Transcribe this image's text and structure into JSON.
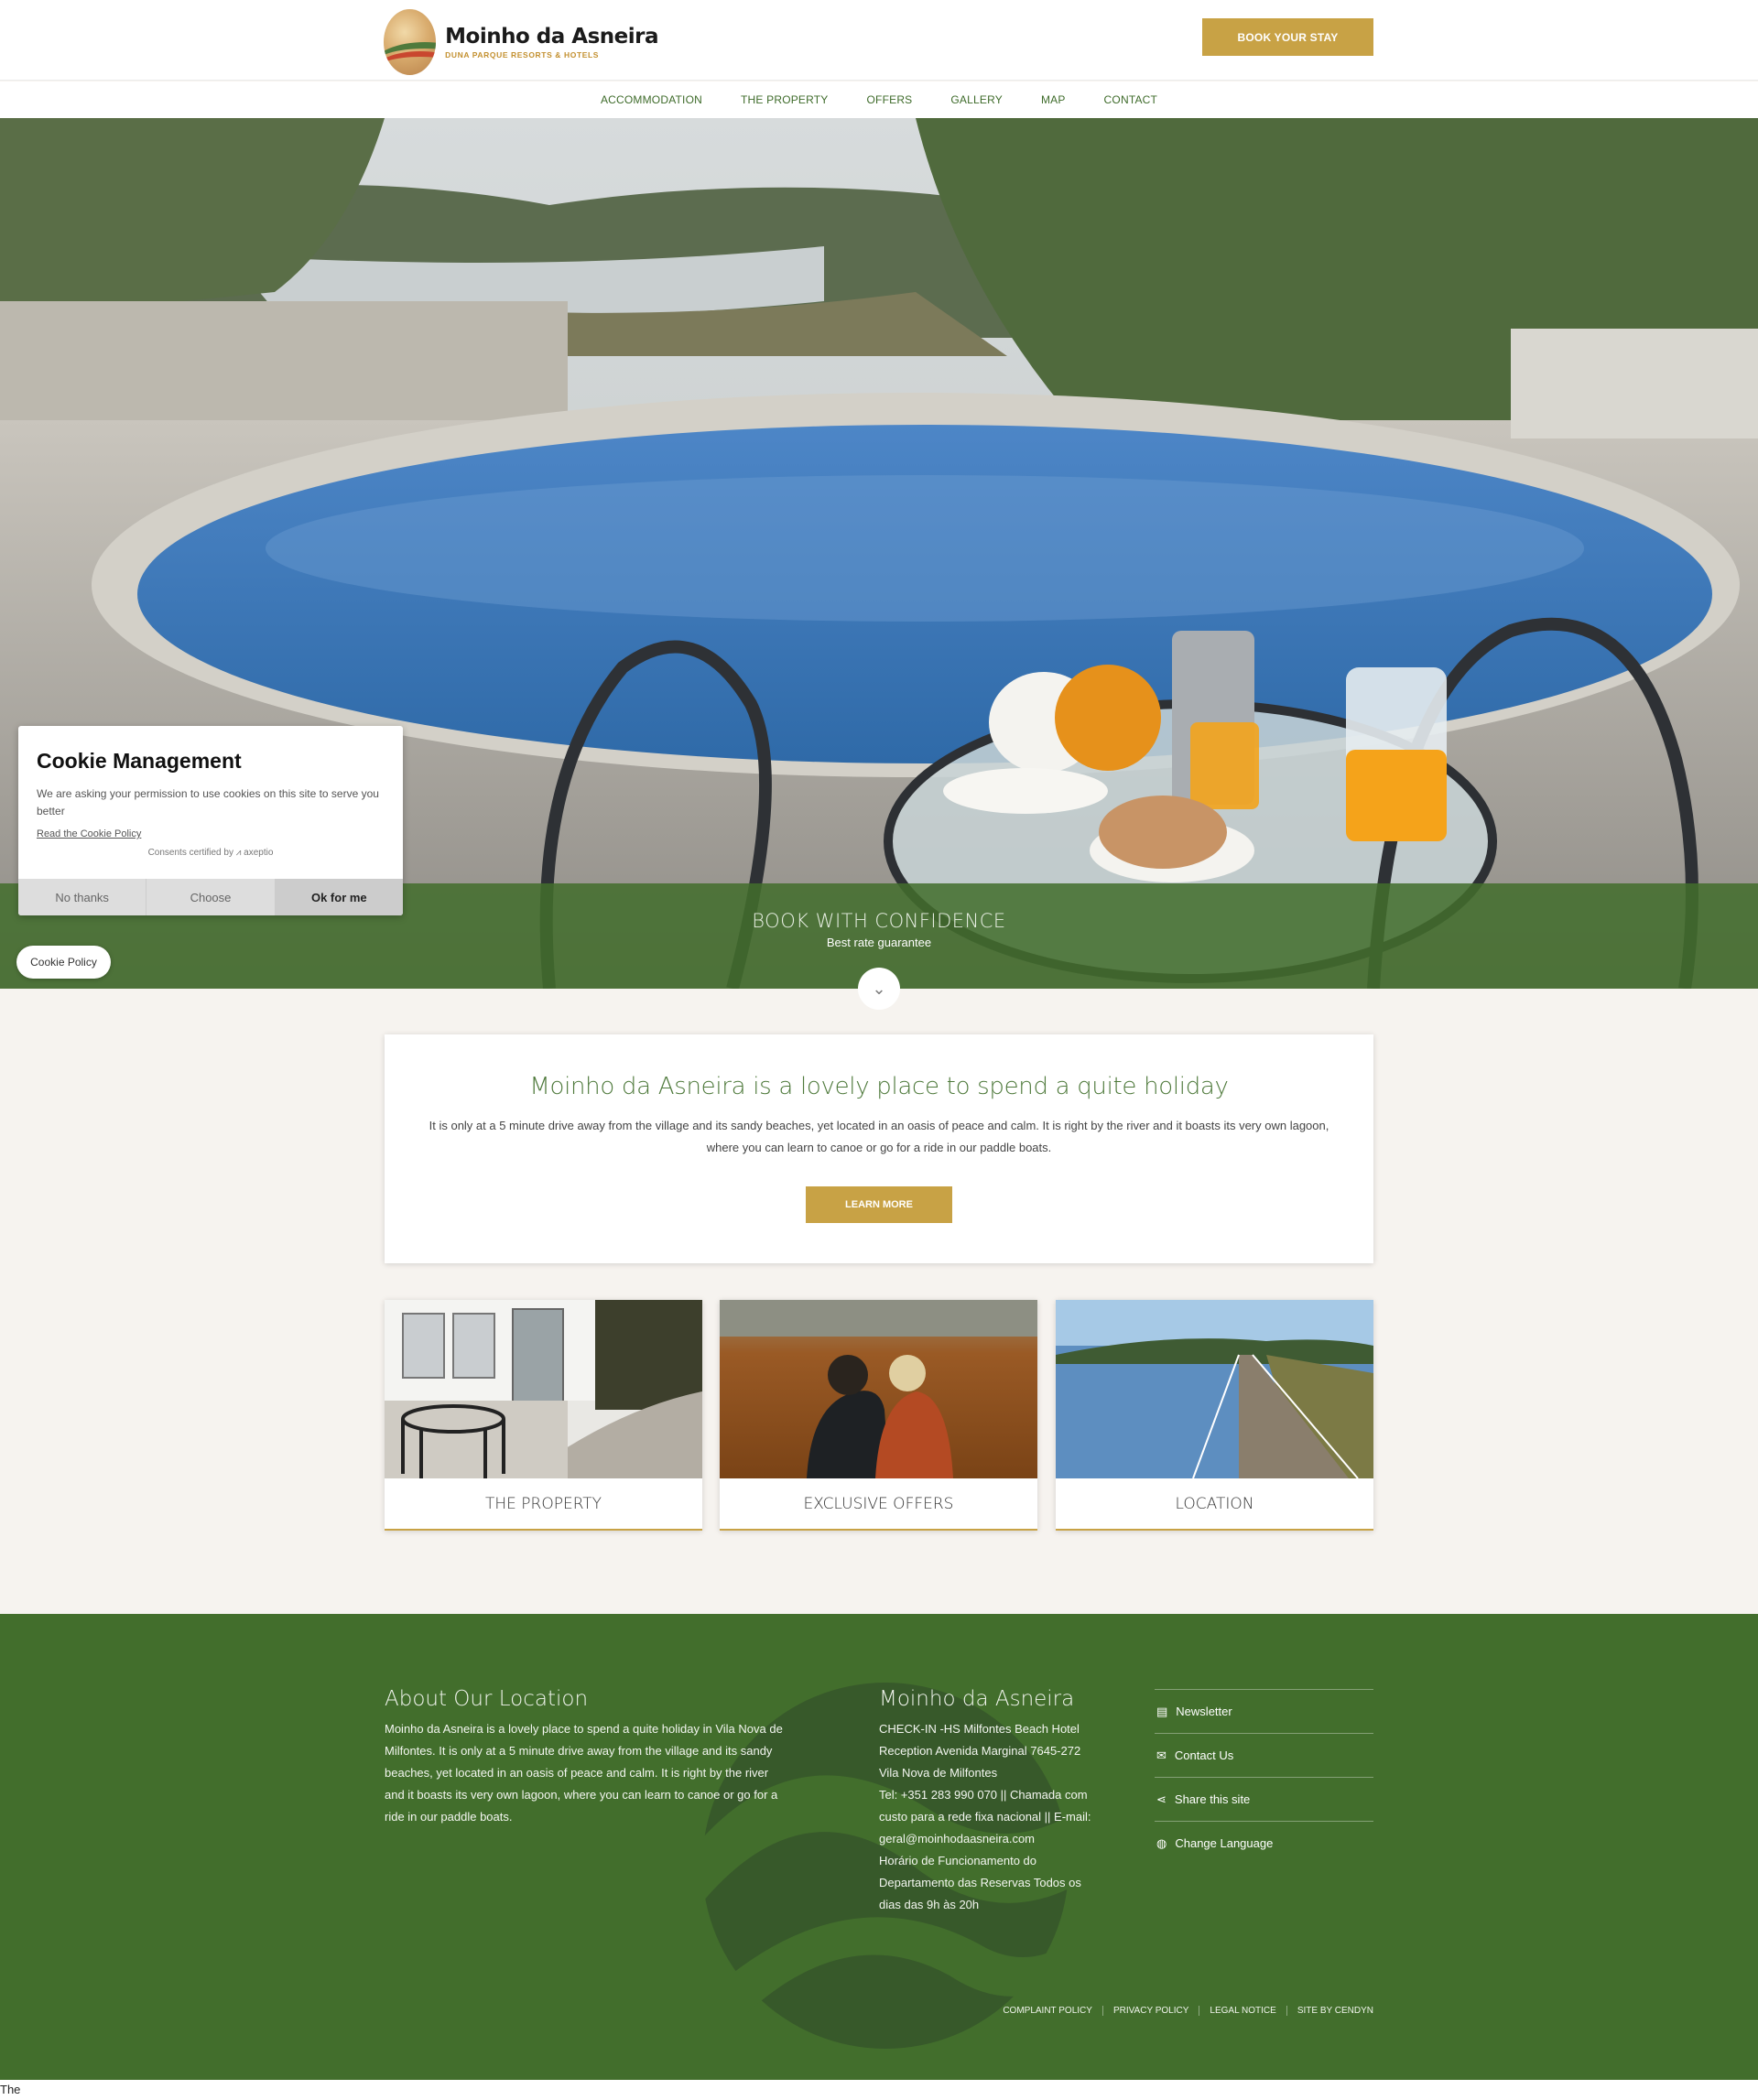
{
  "header": {
    "logo_title": "Moinho da Asneira",
    "logo_subtitle": "DUNA PARQUE RESORTS & HOTELS",
    "book_button": "BOOK YOUR STAY"
  },
  "nav": {
    "items": [
      "ACCOMMODATION",
      "THE PROPERTY",
      "OFFERS",
      "GALLERY",
      "MAP",
      "CONTACT"
    ]
  },
  "hero": {
    "band_title": "BOOK WITH CONFIDENCE",
    "band_subtitle": "Best rate guarantee",
    "scroll_icon": "chevron-down-icon"
  },
  "cookie": {
    "title": "Cookie Management",
    "text": "We are asking your permission to use cookies on this site to serve you better",
    "policy_link": "Read the Cookie Policy",
    "certified": "Consents certified by ⩘ axeptio",
    "buttons": {
      "no": "No thanks",
      "choose": "Choose",
      "ok": "Ok for me"
    },
    "policy_button": "Cookie Policy"
  },
  "intro": {
    "heading": "Moinho da Asneira is a lovely place to spend a quite holiday",
    "text": "It is only at a 5 minute drive away from the village and its sandy beaches, yet located in an oasis of peace and calm. It is right by the river and it boasts its very own lagoon, where you can learn to canoe or go for a ride in our paddle boats.",
    "button": "LEARN MORE"
  },
  "cards": [
    {
      "label": "THE PROPERTY"
    },
    {
      "label": "EXCLUSIVE OFFERS"
    },
    {
      "label": "LOCATION"
    }
  ],
  "footer": {
    "about_title": "About Our Location",
    "about_text": "Moinho da Asneira is a lovely place to spend a quite holiday in Vila Nova de Milfontes. It is only at a 5 minute drive away from the village and its sandy beaches, yet located in an oasis of peace and calm. It is right by the river and it boasts its very own lagoon, where you can learn to canoe or go for a ride in our paddle boats.",
    "contact_title": "Moinho da Asneira",
    "contact_lines": [
      "CHECK-IN -HS Milfontes Beach Hotel",
      "Reception Avenida Marginal 7645-272",
      "Vila Nova de Milfontes",
      "Tel: +351 283 990 070 || Chamada com",
      "custo para a rede fixa nacional || E-mail:",
      "geral@moinhodaasneira.com",
      "Horário de Funcionamento do",
      "Departamento das Reservas Todos os",
      "dias das 9h às 20h"
    ],
    "links": [
      {
        "label": "Newsletter",
        "icon": "newsletter-icon"
      },
      {
        "label": "Contact Us",
        "icon": "envelope-icon"
      },
      {
        "label": "Share this site",
        "icon": "share-icon"
      },
      {
        "label": "Change Language",
        "icon": "globe-icon"
      }
    ],
    "bottom_links": [
      "COMPLAINT POLICY",
      "PRIVACY POLICY",
      "LEGAL NOTICE",
      "SITE BY CENDYN"
    ]
  },
  "status_text": "The"
}
